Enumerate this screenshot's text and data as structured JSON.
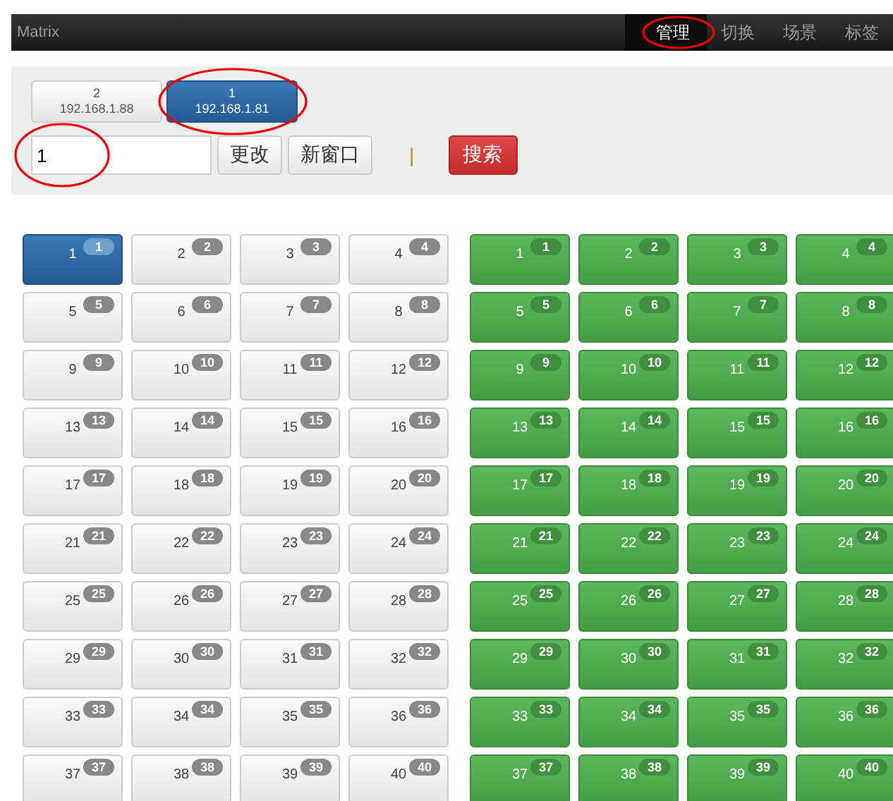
{
  "navbar": {
    "brand": "Matrix",
    "items": [
      {
        "label": "管理",
        "selected": true,
        "annotated": true
      },
      {
        "label": "切换",
        "selected": false,
        "annotated": false
      },
      {
        "label": "场景",
        "selected": false,
        "annotated": false
      },
      {
        "label": "标签",
        "selected": false,
        "annotated": false
      }
    ]
  },
  "devices": [
    {
      "number": "2",
      "ip": "192.168.1.88",
      "selected": false,
      "annotated": false
    },
    {
      "number": "1",
      "ip": "192.168.1.81",
      "selected": true,
      "annotated": true
    }
  ],
  "toolbar": {
    "input": {
      "value": "1",
      "annotated": true
    },
    "buttons": [
      {
        "label": "更改",
        "kind": "default"
      },
      {
        "label": "新窗口",
        "kind": "default"
      },
      {
        "label": "|",
        "kind": "separator"
      },
      {
        "label": "搜索",
        "kind": "danger"
      }
    ]
  },
  "inputs": [
    {
      "label": "1",
      "badge": "1",
      "selected": true
    },
    {
      "label": "2",
      "badge": "2",
      "selected": false
    },
    {
      "label": "3",
      "badge": "3",
      "selected": false
    },
    {
      "label": "4",
      "badge": "4",
      "selected": false
    },
    {
      "label": "5",
      "badge": "5",
      "selected": false
    },
    {
      "label": "6",
      "badge": "6",
      "selected": false
    },
    {
      "label": "7",
      "badge": "7",
      "selected": false
    },
    {
      "label": "8",
      "badge": "8",
      "selected": false
    },
    {
      "label": "9",
      "badge": "9",
      "selected": false
    },
    {
      "label": "10",
      "badge": "10",
      "selected": false
    },
    {
      "label": "11",
      "badge": "11",
      "selected": false
    },
    {
      "label": "12",
      "badge": "12",
      "selected": false
    },
    {
      "label": "13",
      "badge": "13",
      "selected": false
    },
    {
      "label": "14",
      "badge": "14",
      "selected": false
    },
    {
      "label": "15",
      "badge": "15",
      "selected": false
    },
    {
      "label": "16",
      "badge": "16",
      "selected": false
    },
    {
      "label": "17",
      "badge": "17",
      "selected": false
    },
    {
      "label": "18",
      "badge": "18",
      "selected": false
    },
    {
      "label": "19",
      "badge": "19",
      "selected": false
    },
    {
      "label": "20",
      "badge": "20",
      "selected": false
    },
    {
      "label": "21",
      "badge": "21",
      "selected": false
    },
    {
      "label": "22",
      "badge": "22",
      "selected": false
    },
    {
      "label": "23",
      "badge": "23",
      "selected": false
    },
    {
      "label": "24",
      "badge": "24",
      "selected": false
    },
    {
      "label": "25",
      "badge": "25",
      "selected": false
    },
    {
      "label": "26",
      "badge": "26",
      "selected": false
    },
    {
      "label": "27",
      "badge": "27",
      "selected": false
    },
    {
      "label": "28",
      "badge": "28",
      "selected": false
    },
    {
      "label": "29",
      "badge": "29",
      "selected": false
    },
    {
      "label": "30",
      "badge": "30",
      "selected": false
    },
    {
      "label": "31",
      "badge": "31",
      "selected": false
    },
    {
      "label": "32",
      "badge": "32",
      "selected": false
    },
    {
      "label": "33",
      "badge": "33",
      "selected": false
    },
    {
      "label": "34",
      "badge": "34",
      "selected": false
    },
    {
      "label": "35",
      "badge": "35",
      "selected": false
    },
    {
      "label": "36",
      "badge": "36",
      "selected": false
    },
    {
      "label": "37",
      "badge": "37",
      "selected": false
    },
    {
      "label": "38",
      "badge": "38",
      "selected": false
    },
    {
      "label": "39",
      "badge": "39",
      "selected": false
    },
    {
      "label": "40",
      "badge": "40",
      "selected": false
    }
  ],
  "outputs": [
    {
      "label": "1",
      "badge": "1",
      "selected": true
    },
    {
      "label": "2",
      "badge": "2",
      "selected": true
    },
    {
      "label": "3",
      "badge": "3",
      "selected": true
    },
    {
      "label": "4",
      "badge": "4",
      "selected": true
    },
    {
      "label": "5",
      "badge": "5",
      "selected": true
    },
    {
      "label": "6",
      "badge": "6",
      "selected": true
    },
    {
      "label": "7",
      "badge": "7",
      "selected": true
    },
    {
      "label": "8",
      "badge": "8",
      "selected": true
    },
    {
      "label": "9",
      "badge": "9",
      "selected": true
    },
    {
      "label": "10",
      "badge": "10",
      "selected": true
    },
    {
      "label": "11",
      "badge": "11",
      "selected": true
    },
    {
      "label": "12",
      "badge": "12",
      "selected": true
    },
    {
      "label": "13",
      "badge": "13",
      "selected": true
    },
    {
      "label": "14",
      "badge": "14",
      "selected": true
    },
    {
      "label": "15",
      "badge": "15",
      "selected": true
    },
    {
      "label": "16",
      "badge": "16",
      "selected": true
    },
    {
      "label": "17",
      "badge": "17",
      "selected": true
    },
    {
      "label": "18",
      "badge": "18",
      "selected": true
    },
    {
      "label": "19",
      "badge": "19",
      "selected": true
    },
    {
      "label": "20",
      "badge": "20",
      "selected": true
    },
    {
      "label": "21",
      "badge": "21",
      "selected": true
    },
    {
      "label": "22",
      "badge": "22",
      "selected": true
    },
    {
      "label": "23",
      "badge": "23",
      "selected": true
    },
    {
      "label": "24",
      "badge": "24",
      "selected": true
    },
    {
      "label": "25",
      "badge": "25",
      "selected": true
    },
    {
      "label": "26",
      "badge": "26",
      "selected": true
    },
    {
      "label": "27",
      "badge": "27",
      "selected": true
    },
    {
      "label": "28",
      "badge": "28",
      "selected": true
    },
    {
      "label": "29",
      "badge": "29",
      "selected": true
    },
    {
      "label": "30",
      "badge": "30",
      "selected": true
    },
    {
      "label": "31",
      "badge": "31",
      "selected": true
    },
    {
      "label": "32",
      "badge": "32",
      "selected": true
    },
    {
      "label": "33",
      "badge": "33",
      "selected": true
    },
    {
      "label": "34",
      "badge": "34",
      "selected": true
    },
    {
      "label": "35",
      "badge": "35",
      "selected": true
    },
    {
      "label": "36",
      "badge": "36",
      "selected": true
    },
    {
      "label": "37",
      "badge": "37",
      "selected": true
    },
    {
      "label": "38",
      "badge": "38",
      "selected": true
    },
    {
      "label": "39",
      "badge": "39",
      "selected": true
    },
    {
      "label": "40",
      "badge": "40",
      "selected": true
    }
  ]
}
